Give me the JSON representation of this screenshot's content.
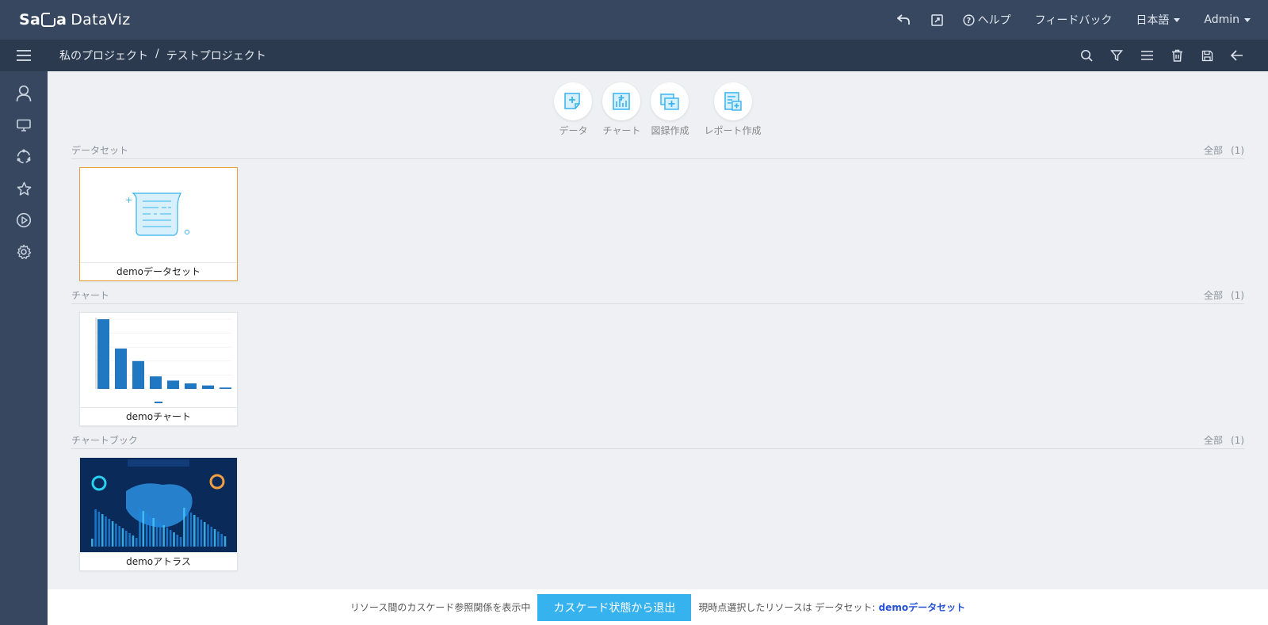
{
  "app": {
    "logo_text": "Sa",
    "logo_text2": "a",
    "logo_suffix": "DataViz"
  },
  "topbar": {
    "icons": [
      "undo-icon",
      "external-link-icon"
    ],
    "help_label": "ヘルプ",
    "feedback_label": "フィードバック",
    "language_label": "日本語",
    "user_label": "Admin"
  },
  "subbar": {
    "breadcrumb": [
      "私のプロジェクト",
      "/",
      "テストプロジェクト"
    ],
    "tools": [
      "search-icon",
      "filter-icon",
      "list-icon",
      "trash-icon",
      "save-icon",
      "back-arrow-icon"
    ]
  },
  "sidebar": {
    "items": [
      "user-icon",
      "monitor-icon",
      "share-icon",
      "star-icon",
      "play-icon",
      "gear-icon"
    ]
  },
  "create": {
    "items": [
      {
        "label": "データ"
      },
      {
        "label": "チャート"
      },
      {
        "label": "図録作成"
      },
      {
        "label": "レポート作成"
      }
    ]
  },
  "sections": [
    {
      "title": "データセット",
      "all_label": "全部",
      "count": "(1)",
      "item": "demoデータセット"
    },
    {
      "title": "チャート",
      "all_label": "全部",
      "count": "(1)",
      "item": "demoチャート"
    },
    {
      "title": "チャートブック",
      "all_label": "全部",
      "count": "(1)",
      "item": "demoアトラス"
    }
  ],
  "thumb_chart": {
    "values": [
      100,
      58,
      40,
      18,
      12,
      8,
      5,
      2
    ]
  },
  "bottom": {
    "info_text": "リソース間のカスケード参照関係を表示中",
    "exit_label": "カスケード状態から退出",
    "selected_prefix": "現時点選択したリソースは データセット:",
    "selected_name": "demoデータセット"
  },
  "colors": {
    "accent": "#36b2ef",
    "topbar": "#37475f",
    "selected_border": "#e8a33d"
  }
}
